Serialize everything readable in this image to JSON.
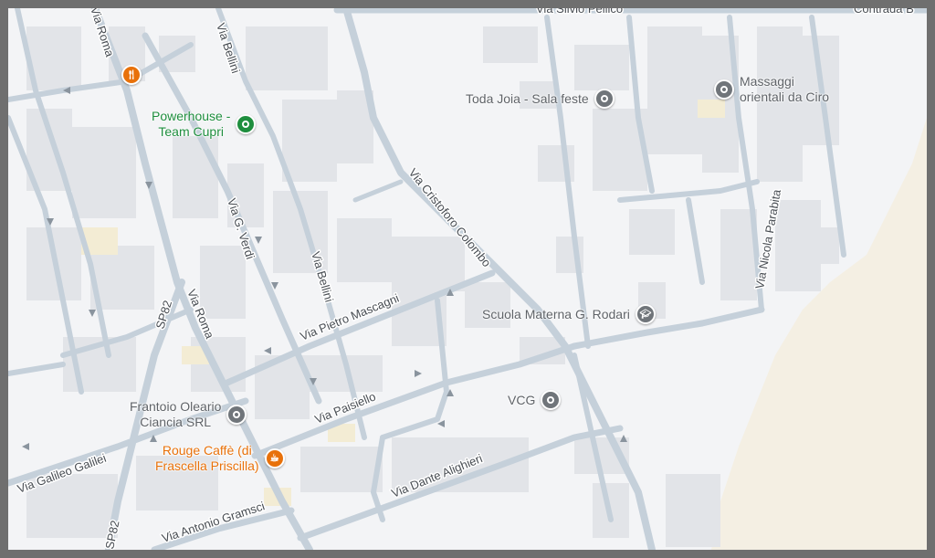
{
  "map": {
    "streets": [
      "Via Silvio Pellico",
      "Contrada B",
      "Via Roma",
      "Via Bellini",
      "Via Cristoforo Colombo",
      "Via G. Verdi",
      "Via Bellini",
      "Via Nicola Parabita",
      "Via Pietro Mascagni",
      "SP82",
      "Via Roma",
      "Via Paisiello",
      "Via Galileo Galilei",
      "Via Dante Alighieri",
      "Via Antonio Gramsci",
      "SP82"
    ],
    "places": [
      {
        "name": "Powerhouse -\nTeam Cupri",
        "icon": "location-pin-icon",
        "color": "#1e8e3e"
      },
      {
        "name": "Toda Joia - Sala feste",
        "icon": "location-pin-icon",
        "color": "#70757a"
      },
      {
        "name": "Massaggi\norientali da Ciro",
        "icon": "location-pin-icon",
        "color": "#70757a"
      },
      {
        "name": "Scuola Materna G. Rodari",
        "icon": "school-icon",
        "color": "#70757a"
      },
      {
        "name": "VCG",
        "icon": "location-pin-icon",
        "color": "#70757a"
      },
      {
        "name": "Frantoio Oleario\nCiancia SRL",
        "icon": "location-pin-icon",
        "color": "#70757a"
      },
      {
        "name": "Rouge Caffè (di\nFrascella Priscilla)",
        "icon": "coffee-icon",
        "color": "#e8710a"
      },
      {
        "name": "",
        "icon": "restaurant-icon",
        "color": "#e8710a"
      }
    ],
    "colors": {
      "background": "#f3f4f6",
      "road": "#c5d0da",
      "building": "#e3e5e9",
      "sand": "#f4efe3",
      "frame": "#6f6f6f"
    }
  }
}
